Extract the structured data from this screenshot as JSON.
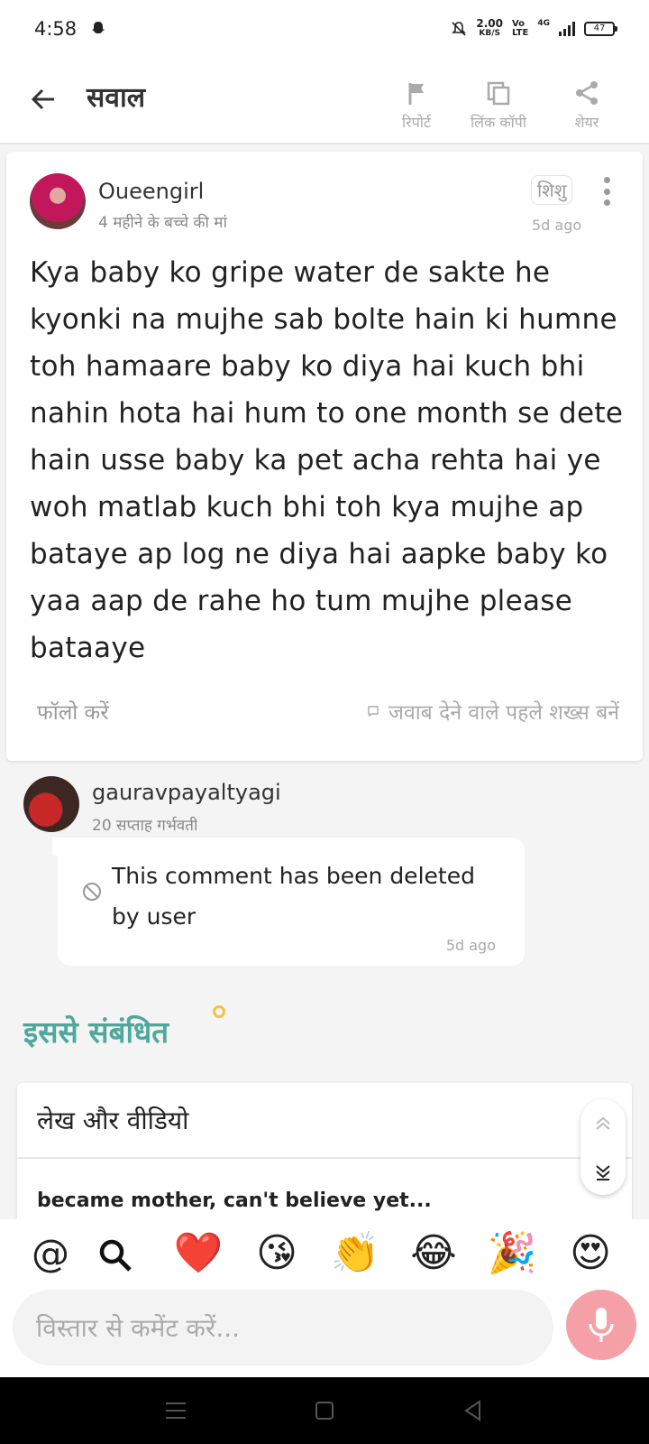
{
  "status_bar": {
    "time": "4:58",
    "speed_value": "2.00",
    "speed_unit": "KB/S",
    "volte_top": "Vo",
    "volte_bottom": "LTE",
    "network": "4G",
    "battery": "47",
    "icons": [
      "snapchat-icon",
      "mute-icon",
      "signal-icon",
      "battery-icon"
    ]
  },
  "header": {
    "title": "सवाल",
    "actions": [
      {
        "label": "रिपोर्ट",
        "icon": "flag-icon"
      },
      {
        "label": "लिंक कॉपी",
        "icon": "copy-icon"
      },
      {
        "label": "शेयर",
        "icon": "share-icon"
      }
    ]
  },
  "question": {
    "username": "Oueengirl",
    "subtitle": "4 महीने के बच्चे की मां",
    "tag": "शिशु",
    "time": "5d ago",
    "text": "Kya baby ko gripe water de sakte he kyonki na mujhe sab bolte hain ki humne toh hamaare baby ko diya hai kuch bhi nahin hota hai hum to one month se dete hain usse baby ka pet acha rehta hai ye woh matlab kuch bhi toh kya mujhe ap bataye ap log ne diya hai aapke baby ko yaa aap de rahe ho tum mujhe please bataaye",
    "follow_label": "फॉलो करें",
    "answer_first_label": "जवाब देने वाले पहले शख्स बनें"
  },
  "comment": {
    "username": "gauravpayaltyagi",
    "subtitle": "20 सप्ताह गर्भवती",
    "text": "This comment has been deleted by user",
    "time": "5d ago"
  },
  "related": {
    "title": "इससे संबंधित",
    "section_heading": "लेख और वीडियो",
    "items": [
      "became mother, can't believe yet..."
    ]
  },
  "emoji_bar": {
    "at": "@",
    "emojis": [
      "❤️",
      "😘",
      "👏",
      "😂",
      "🎉",
      "😍"
    ]
  },
  "comment_input": {
    "placeholder": "विस्तार से कमेंट करें..."
  },
  "colors": {
    "accent_teal": "#4fa89a",
    "mic_pink": "#f4a0a6",
    "dot_yellow": "#f5c043"
  }
}
